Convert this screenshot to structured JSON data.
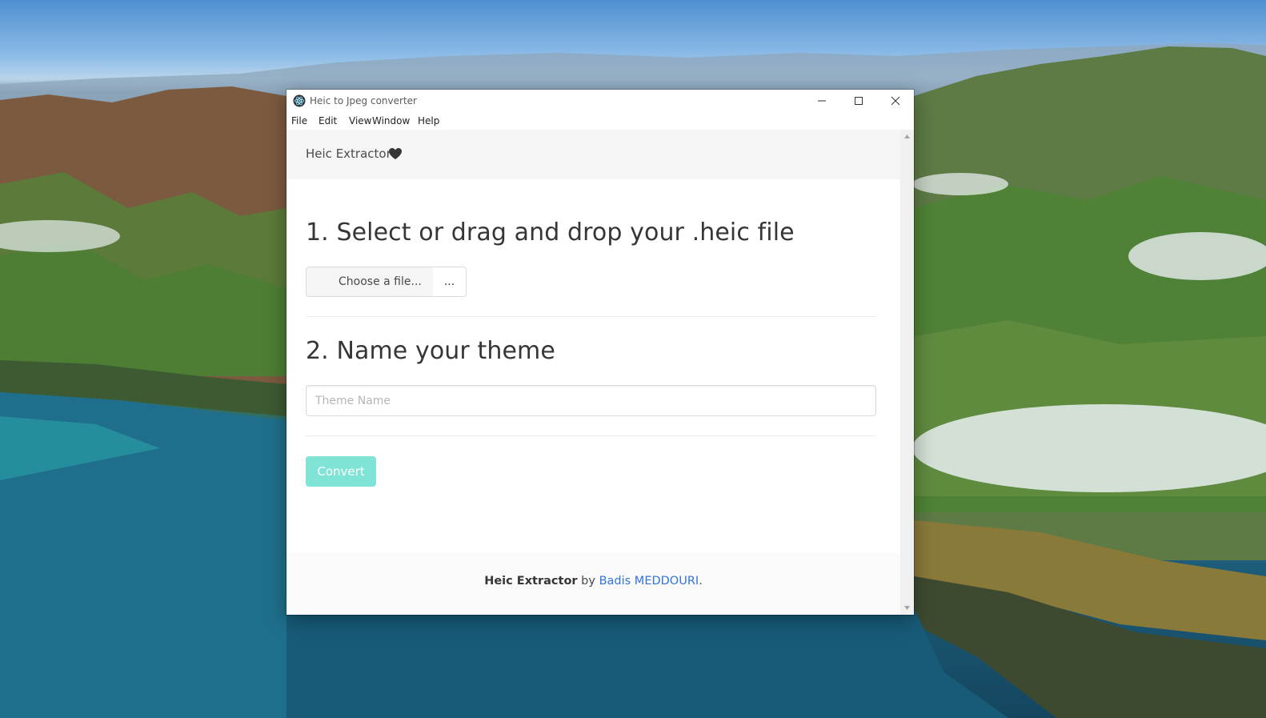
{
  "window": {
    "title": "Heic to Jpeg converter"
  },
  "menu": {
    "items": [
      "File",
      "Edit",
      "View",
      "Window",
      "Help"
    ]
  },
  "navbar": {
    "brand": "Heic Extractor",
    "brand_icon": "heart-icon"
  },
  "steps": {
    "select_heading": "1. Select or drag and drop your .heic file",
    "choose_file_label": "Choose a file...",
    "file_name_placeholder": "...",
    "name_heading": "2. Name your theme",
    "theme_name_placeholder": "Theme Name",
    "theme_name_value": ""
  },
  "actions": {
    "convert_label": "Convert"
  },
  "footer": {
    "app_name": "Heic Extractor",
    "by": " by ",
    "author": "Badis MEDDOURI",
    "period": "."
  },
  "colors": {
    "convert_button": "#7fe3d5",
    "link": "#3273dc",
    "navbar_bg": "#f5f5f5",
    "footer_bg": "#fafafa"
  }
}
